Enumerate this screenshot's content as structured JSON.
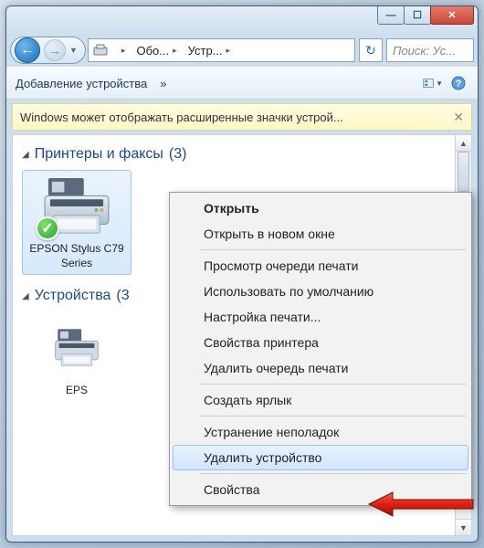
{
  "titlebar": {
    "minimize": "—",
    "maximize": "☐",
    "close": "✕"
  },
  "nav": {
    "back": "←",
    "forward": "→"
  },
  "address": {
    "seg1": "Обо...",
    "seg2": "Устр..."
  },
  "search": {
    "placeholder": "Поиск: Ус..."
  },
  "toolbar": {
    "add_device": "Добавление устройства",
    "more": "»"
  },
  "infobar": {
    "text": "Windows может отображать расширенные значки устрой...",
    "close": "✕"
  },
  "groups": {
    "printers": {
      "label": "Принтеры и факсы",
      "count": "(3)"
    },
    "devices": {
      "label": "Устройства",
      "count": "(3"
    }
  },
  "items": {
    "printer1": "EPSON Stylus C79 Series",
    "device1": "EPS"
  },
  "context_menu": {
    "open": "Открыть",
    "open_new": "Открыть в новом окне",
    "view_queue": "Просмотр очереди печати",
    "use_default": "Использовать по умолчанию",
    "print_settings": "Настройка печати...",
    "printer_props": "Свойства принтера",
    "clear_queue": "Удалить очередь печати",
    "shortcut": "Создать ярлык",
    "troubleshoot": "Устранение неполадок",
    "remove_device": "Удалить устройство",
    "properties": "Свойства"
  }
}
